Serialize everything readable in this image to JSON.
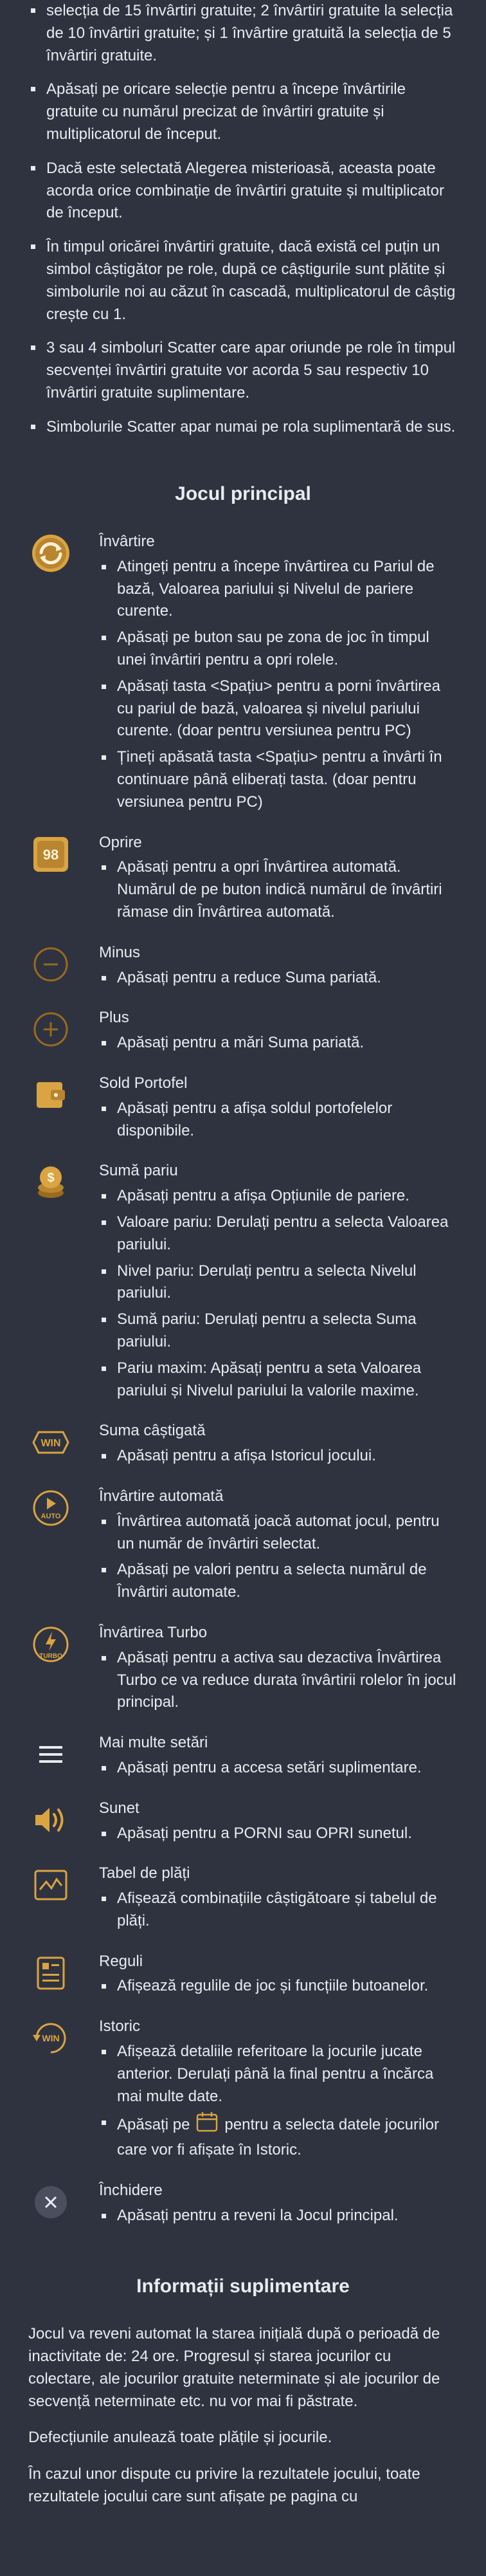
{
  "intro": {
    "bullets": [
      "selecția de 15 învârtiri gratuite; 2 învârtiri gratuite la selecția de 10 învârtiri gratuite; și 1 învârtire gratuită la selecția de 5 învârtiri gratuite.",
      "Apăsați pe oricare selecție pentru a începe învârtirile gratuite cu numărul precizat de învârtiri gratuite și multiplicatorul de început.",
      "Dacă este selectată Alegerea misterioasă, aceasta poate acorda orice combinație de învârtiri gratuite și multiplicator de început.",
      "În timpul oricărei învârtiri gratuite, dacă există cel puțin un simbol câștigător pe role, după ce câștigurile sunt plătite și simbolurile noi au căzut în cascadă, multiplicatorul de câștig crește cu 1.",
      "3 sau 4 simboluri Scatter care apar oriunde pe role în timpul secvenței învârtiri gratuite vor acorda 5 sau respectiv 10 învârtiri gratuite suplimentare.",
      "Simbolurile Scatter apar numai pe rola suplimentară de sus."
    ]
  },
  "main_game": {
    "title": "Jocul principal",
    "items": [
      {
        "icon": "spin-icon",
        "title": "Învârtire",
        "bullets": [
          "Atingeți pentru a începe învârtirea cu Pariul de bază, Valoarea pariului și Nivelul de pariere curente.",
          "Apăsați pe buton sau pe zona de joc în timpul unei învârtiri pentru a opri rolele.",
          "Apăsați tasta <Spațiu> pentru a porni învârtirea cu pariul de bază, valoarea și nivelul pariului curente. (doar pentru versiunea pentru PC)",
          "Țineți apăsată tasta <Spațiu> pentru a învârti în continuare până eliberați tasta. (doar pentru versiunea pentru PC)"
        ]
      },
      {
        "icon": "stop-icon",
        "title": "Oprire",
        "bullets": [
          "Apăsați pentru a opri Învârtirea automată. Numărul de pe buton indică numărul de învârtiri rămase din Învârtirea automată."
        ]
      },
      {
        "icon": "minus-icon",
        "title": "Minus",
        "bullets": [
          "Apăsați pentru a reduce Suma pariată."
        ]
      },
      {
        "icon": "plus-icon",
        "title": "Plus",
        "bullets": [
          "Apăsați pentru a mări Suma pariată."
        ]
      },
      {
        "icon": "wallet-icon",
        "title": "Sold Portofel",
        "bullets": [
          "Apăsați pentru a afișa soldul portofelelor disponibile."
        ]
      },
      {
        "icon": "coins-icon",
        "title": "Sumă pariu",
        "bullets": [
          "Apăsați pentru a afișa Opțiunile de pariere.",
          "Valoare pariu: Derulați pentru a selecta Valoarea pariului.",
          "Nivel pariu: Derulați pentru a selecta Nivelul pariului.",
          "Sumă pariu: Derulați pentru a selecta Suma pariului.",
          "Pariu maxim: Apăsați pentru a seta Valoarea pariului și Nivelul pariului la valorile maxime."
        ]
      },
      {
        "icon": "win-icon",
        "title": "Suma câștigată",
        "bullets": [
          "Apăsați pentru a afișa Istoricul jocului."
        ]
      },
      {
        "icon": "auto-icon",
        "title": "Învârtire automată",
        "icon_label": "AUTO",
        "bullets": [
          "Învârtirea automată joacă automat jocul, pentru un număr de învârtiri selectat.",
          "Apăsați pe valori pentru a selecta numărul de Învârtiri automate."
        ]
      },
      {
        "icon": "turbo-icon",
        "title": "Învârtirea Turbo",
        "icon_label": "TURBO",
        "bullets": [
          "Apăsați pentru a activa sau dezactiva Învârtirea Turbo ce va reduce durata învârtirii rolelor în jocul principal."
        ]
      },
      {
        "icon": "menu-icon",
        "title": "Mai multe setări",
        "bullets": [
          "Apăsați pentru a accesa setări suplimentare."
        ]
      },
      {
        "icon": "sound-icon",
        "title": "Sunet",
        "bullets": [
          "Apăsați pentru a PORNI sau OPRI sunetul."
        ]
      },
      {
        "icon": "paytable-icon",
        "title": "Tabel de plăți",
        "bullets": [
          "Afișează combinațiile câștigătoare și tabelul de plăți."
        ]
      },
      {
        "icon": "rules-icon",
        "title": "Reguli",
        "bullets": [
          "Afișează regulile de joc și funcțiile butoanelor."
        ]
      },
      {
        "icon": "history-icon",
        "title": "Istoric",
        "bullets": [
          "Afișează detaliile referitoare la jocurile jucate anterior. Derulați până la final pentru a încărca mai multe date."
        ],
        "date_bullet_before": "Apăsați pe",
        "date_bullet_after": "pentru a selecta datele jocurilor care vor fi afișate în Istoric."
      },
      {
        "icon": "close-icon",
        "title": "Închidere",
        "bullets": [
          "Apăsați pentru a reveni la Jocul principal."
        ]
      }
    ],
    "win_text": "WIN"
  },
  "additional": {
    "title": "Informații suplimentare",
    "paragraphs": [
      "Jocul va reveni automat la starea inițială după o perioadă de inactivitate de: 24 ore. Progresul și starea jocurilor cu colectare, ale jocurilor gratuite neterminate și ale jocurilor de secvență neterminate etc. nu vor mai fi păstrate.",
      "Defecțiunile anulează toate plățile și jocurile.",
      "În cazul unor dispute cu privire la rezultatele jocului, toate rezultatele jocului care sunt afișate pe pagina cu"
    ]
  },
  "colors": {
    "background": "#2f3340",
    "text": "#e9ebf0",
    "gold": "#d9a441",
    "gold_dark": "#9a6a1e"
  }
}
